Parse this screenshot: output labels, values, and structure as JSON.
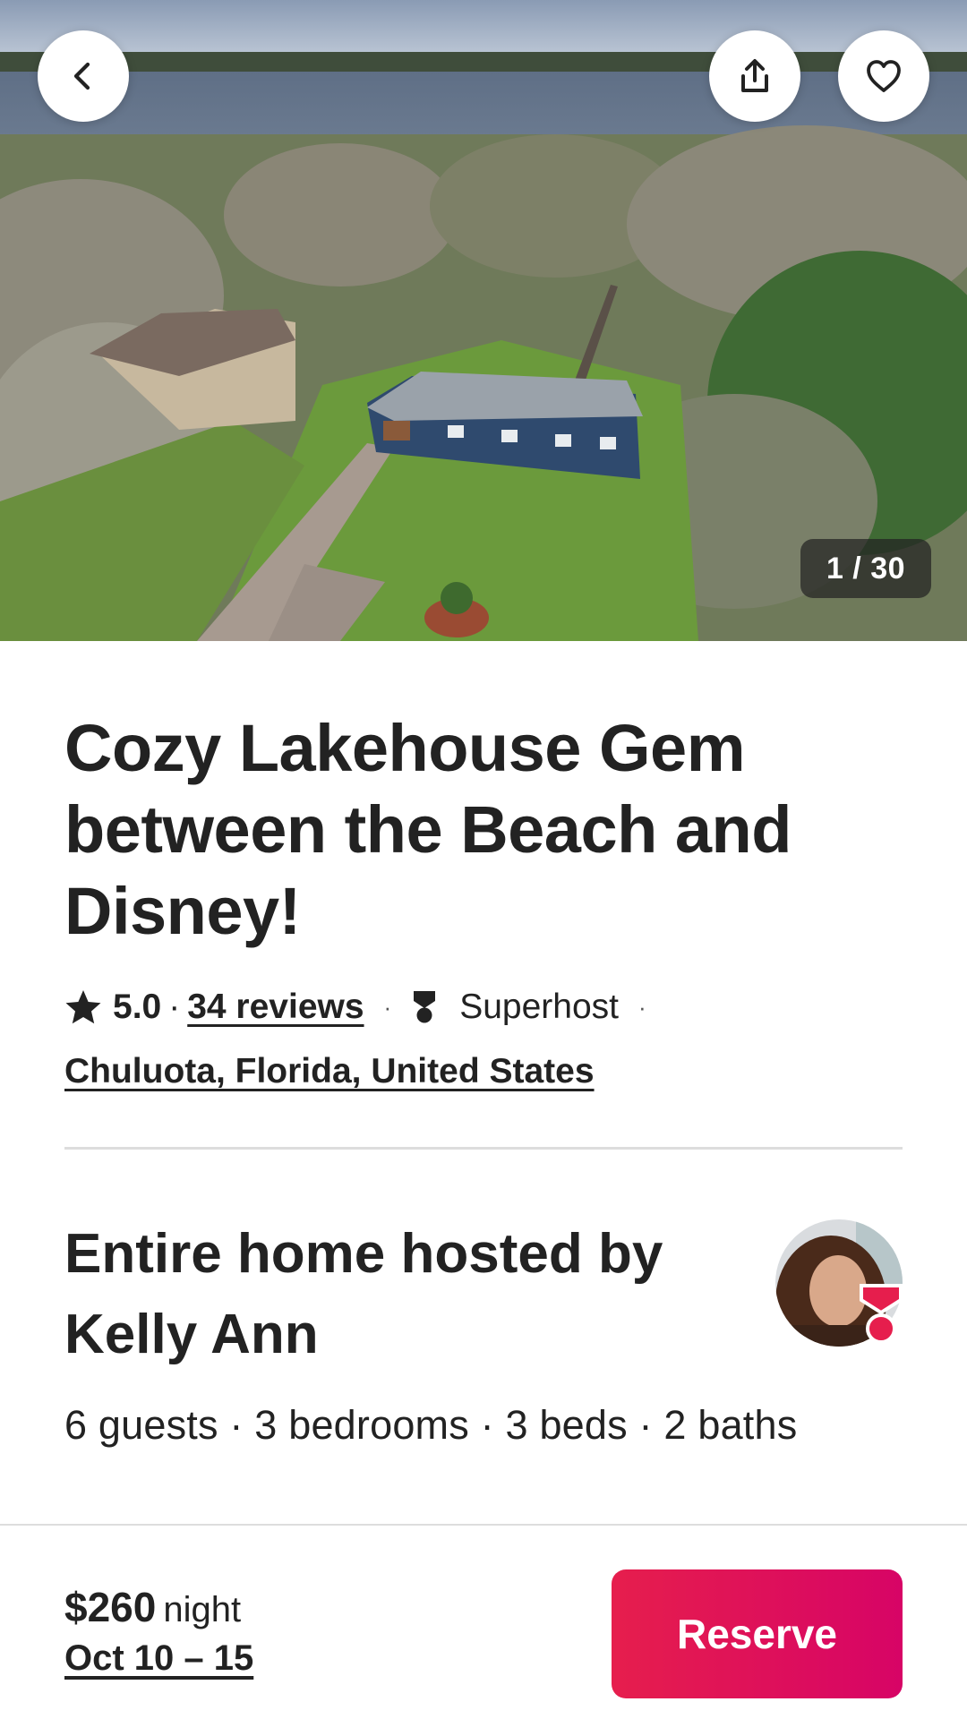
{
  "hero": {
    "photo_counter": "1 / 30",
    "icons": {
      "back": "chevron-left-icon",
      "share": "share-icon",
      "favorite": "heart-icon"
    }
  },
  "listing": {
    "title": "Cozy Lakehouse Gem between the Beach and Disney!",
    "rating": "5.0",
    "rating_separator": "·",
    "reviews": "34 reviews",
    "superhost": "Superhost",
    "location": "Chuluota, Florida, United States"
  },
  "host": {
    "home_type": "Entire home hosted by Kelly Ann",
    "specs": "6 guests · 3 bedrooms · 3 beds · 2 baths"
  },
  "booking": {
    "price": "$260",
    "price_unit": "night",
    "dates": "Oct 10 – 15",
    "reserve_label": "Reserve"
  },
  "colors": {
    "brand": "#E61E4D",
    "brand_end": "#D70466",
    "text": "#222222",
    "divider": "#DDDDDD"
  }
}
